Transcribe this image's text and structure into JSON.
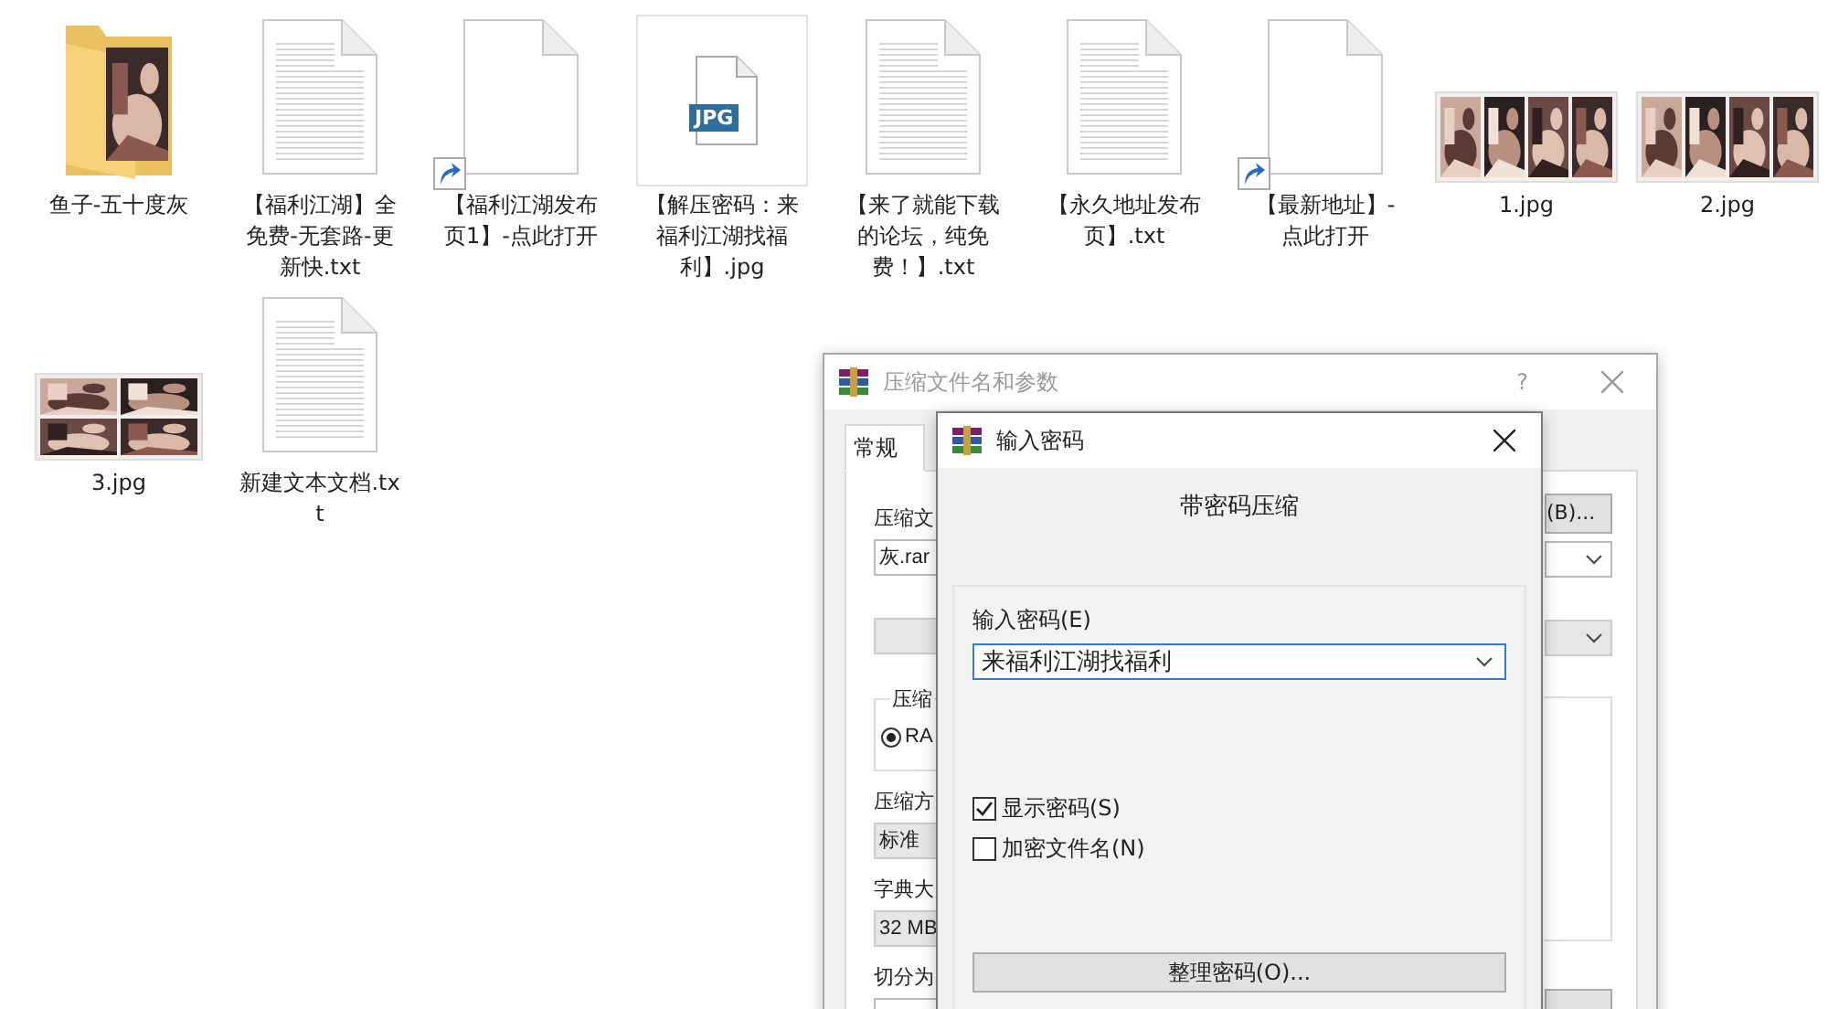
{
  "desktop_items": [
    {
      "kind": "folder",
      "label": "鱼子-五十度灰"
    },
    {
      "kind": "text",
      "label": "【福利江湖】全免费-无套路-更新快.txt"
    },
    {
      "kind": "shortcut",
      "label": "【福利江湖发布页1】-点此打开"
    },
    {
      "kind": "jpg",
      "label": "【解压密码：来福利江湖找福利】.jpg",
      "badge": "JPG"
    },
    {
      "kind": "text",
      "label": "【来了就能下载的论坛，纯免费！】.txt"
    },
    {
      "kind": "text",
      "label": "【永久地址发布页】.txt"
    },
    {
      "kind": "shortcut",
      "label": "【最新地址】-点此打开"
    },
    {
      "kind": "strip",
      "label": "1.jpg"
    },
    {
      "kind": "strip",
      "label": "2.jpg"
    },
    {
      "kind": "grid",
      "label": "3.jpg"
    },
    {
      "kind": "text",
      "label": "新建文本文档.txt"
    }
  ],
  "archive_dialog": {
    "title": "压缩文件名和参数",
    "help": "?",
    "tabs": [
      {
        "label": "常规",
        "selected": true
      }
    ],
    "archive_label": "压缩文",
    "archive_name": "灰.rar",
    "browse_button": "(B)...",
    "format_group": "压缩",
    "format_radio": {
      "label": "RA",
      "selected": true
    },
    "method_label": "压缩方",
    "method_value": "标准",
    "dict_label": "字典大",
    "dict_value": "32 MB",
    "split_label": "切分为"
  },
  "password_dialog": {
    "title": "输入密码",
    "heading": "带密码压缩",
    "password_label": "输入密码(E)",
    "password_value": "来福利江湖找福利",
    "options": [
      {
        "label": "显示密码(S)",
        "checked": true
      },
      {
        "label": "加密文件名(N)",
        "checked": false
      }
    ],
    "button": "整理密码(O)..."
  }
}
